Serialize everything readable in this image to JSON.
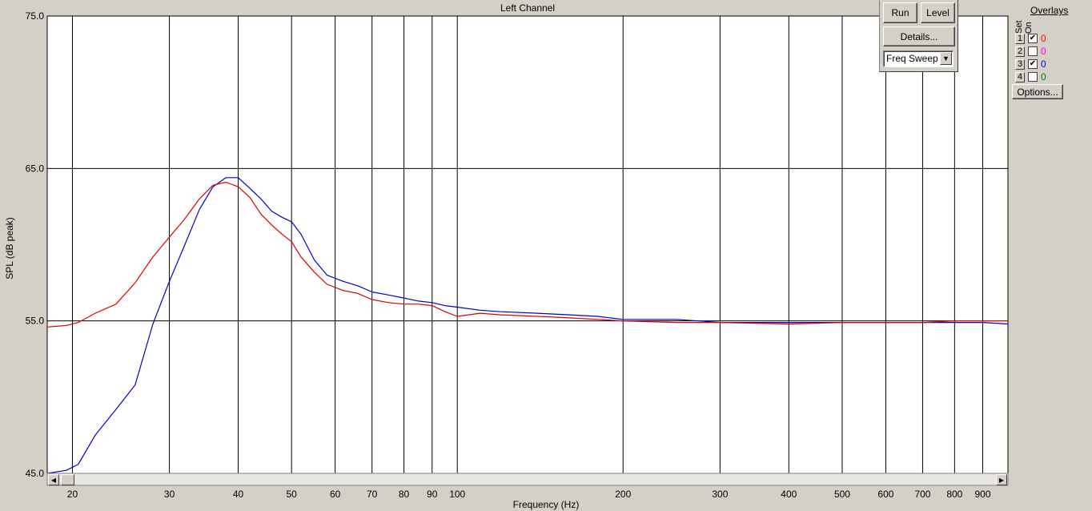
{
  "chart_data": {
    "type": "line",
    "title": "Left Channel",
    "xlabel": "Frequency (Hz)",
    "ylabel": "SPL (dB peak)",
    "xscale": "log",
    "xlim": [
      18,
      1000
    ],
    "ylim": [
      45,
      75
    ],
    "x_ticks": [
      20,
      30,
      40,
      50,
      60,
      70,
      80,
      90,
      100,
      200,
      300,
      400,
      500,
      600,
      700,
      800,
      900
    ],
    "y_ticks": [
      45.0,
      55.0,
      65.0,
      75.0
    ],
    "y_tick_labels": [
      "45.0",
      "55.0",
      "65.0",
      "75.0"
    ],
    "grid": true,
    "background": "#ffffff",
    "series": [
      {
        "color": "#0000cc",
        "x": [
          18,
          19.5,
          20.5,
          22,
          24,
          26,
          28,
          30,
          32,
          34,
          36,
          38,
          40,
          42,
          44,
          46,
          48,
          50,
          52,
          55,
          58,
          62,
          66,
          70,
          75,
          80,
          85,
          90,
          95,
          100,
          110,
          120,
          140,
          160,
          180,
          200,
          250,
          300,
          400,
          500,
          600,
          700,
          800,
          900,
          1000
        ],
        "y": [
          45.0,
          45.2,
          45.6,
          47.5,
          49.2,
          50.8,
          54.8,
          57.6,
          60.0,
          62.3,
          63.8,
          64.4,
          64.4,
          63.7,
          63.0,
          62.2,
          61.8,
          61.5,
          60.7,
          59.0,
          58.0,
          57.6,
          57.3,
          56.9,
          56.7,
          56.5,
          56.3,
          56.2,
          56.0,
          55.9,
          55.7,
          55.6,
          55.5,
          55.4,
          55.3,
          55.1,
          55.1,
          54.9,
          54.9,
          54.9,
          54.9,
          54.9,
          54.9,
          54.9,
          54.8
        ]
      },
      {
        "color": "#dd0000",
        "x": [
          18,
          19.5,
          20.5,
          22,
          24,
          26,
          28,
          30,
          32,
          34,
          36,
          38,
          40,
          42,
          44,
          46,
          48,
          50,
          52,
          55,
          58,
          62,
          66,
          70,
          75,
          80,
          85,
          90,
          95,
          100,
          110,
          120,
          140,
          160,
          180,
          200,
          250,
          300,
          400,
          500,
          600,
          700,
          800,
          900,
          1000
        ],
        "y": [
          54.6,
          54.7,
          54.9,
          55.5,
          56.1,
          57.5,
          59.2,
          60.5,
          61.7,
          63.0,
          63.9,
          64.1,
          63.8,
          63.1,
          62.0,
          61.3,
          60.7,
          60.2,
          59.2,
          58.2,
          57.4,
          57.0,
          56.8,
          56.4,
          56.2,
          56.1,
          56.1,
          56.0,
          55.6,
          55.3,
          55.5,
          55.4,
          55.3,
          55.2,
          55.1,
          55.0,
          54.9,
          54.9,
          54.8,
          54.9,
          54.9,
          54.9,
          55.0,
          55.0,
          55.0
        ]
      }
    ]
  },
  "controls": {
    "run_label": "Run",
    "level_label": "Level",
    "details_label": "Details...",
    "mode_select_value": "Freq Sweep"
  },
  "overlays": {
    "title": "Overlays",
    "set_header": "Set",
    "on_header": "On",
    "rows": [
      {
        "set": "1",
        "checked": true,
        "value": "0",
        "color": "#ff0000"
      },
      {
        "set": "2",
        "checked": false,
        "value": "0",
        "color": "#ff00ff"
      },
      {
        "set": "3",
        "checked": true,
        "value": "0",
        "color": "#0000ff"
      },
      {
        "set": "4",
        "checked": false,
        "value": "0",
        "color": "#008000"
      }
    ],
    "options_label": "Options..."
  }
}
